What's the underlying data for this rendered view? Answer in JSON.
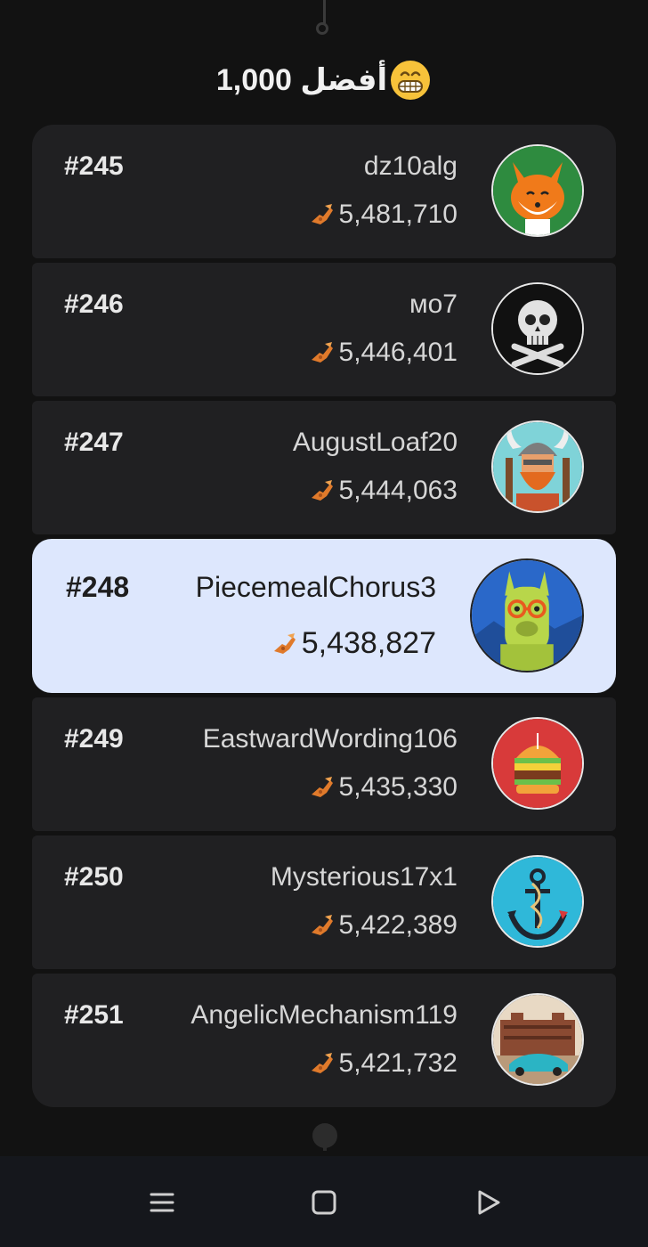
{
  "header": {
    "title": "1,000 أفضل",
    "emoji_icon": "grinning-face-icon"
  },
  "colors": {
    "background": "#121212",
    "row_background": "#202022",
    "highlight_background": "#dde7fd",
    "coin": "#e07a2b"
  },
  "currency_icon": "coin-hand-icon",
  "leaderboard": [
    {
      "rank": "#245",
      "name": "dz10alg",
      "score": "5,481,710",
      "avatar": "fox-avatar-icon"
    },
    {
      "rank": "#246",
      "name": "мо7",
      "score": "5,446,401",
      "avatar": "skull-crossbones-avatar-icon"
    },
    {
      "rank": "#247",
      "name": "AugustLoaf20",
      "score": "5,444,063",
      "avatar": "viking-avatar-icon"
    },
    {
      "rank": "#248",
      "name": "PiecemealChorus3",
      "score": "5,438,827",
      "avatar": "llama-avatar-icon",
      "highlighted": true
    },
    {
      "rank": "#249",
      "name": "EastwardWording106",
      "score": "5,435,330",
      "avatar": "burger-avatar-icon"
    },
    {
      "rank": "#250",
      "name": "Mysterious17x1",
      "score": "5,422,389",
      "avatar": "anchor-avatar-icon"
    },
    {
      "rank": "#251",
      "name": "AngelicMechanism119",
      "score": "5,421,732",
      "avatar": "car-building-avatar-icon"
    }
  ],
  "navbar": {
    "buttons": [
      "menu-icon",
      "home-square-icon",
      "back-triangle-icon"
    ]
  }
}
